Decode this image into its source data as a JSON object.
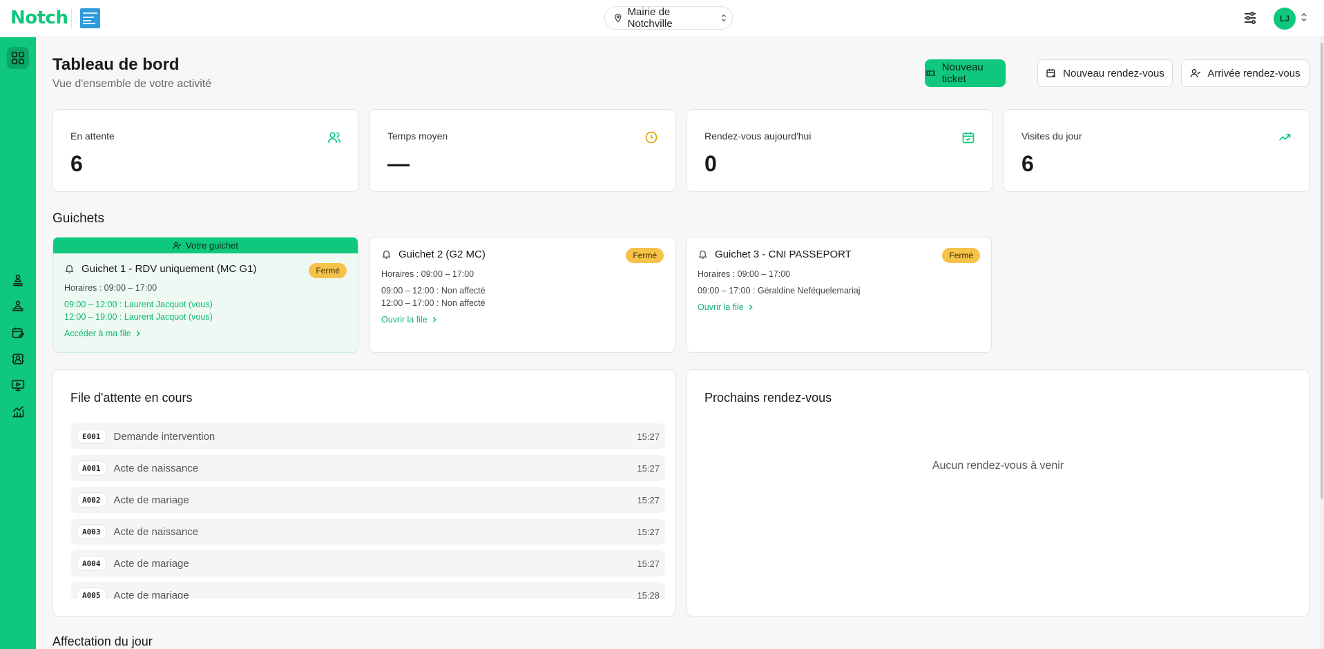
{
  "header": {
    "logo": "Notch",
    "partner_logo": "partner-logo",
    "location": "Mairie de Notchville",
    "avatar_initials": "LJ"
  },
  "sidebar": {
    "items": [
      {
        "icon": "dashboard-icon",
        "active": true
      },
      {
        "icon": "queue-icon"
      },
      {
        "icon": "counter-icon"
      },
      {
        "icon": "calendar-edit-icon"
      },
      {
        "icon": "id-card-icon"
      },
      {
        "icon": "screen-icon"
      },
      {
        "icon": "stats-icon"
      }
    ]
  },
  "page": {
    "title": "Tableau de bord",
    "subtitle": "Vue d'ensemble de votre activité"
  },
  "actions": {
    "new_ticket": "Nouveau ticket",
    "new_appointment": "Nouveau rendez-vous",
    "appointment_arrival": "Arrivée rendez-vous"
  },
  "stats": [
    {
      "label": "En attente",
      "value": "6",
      "icon": "users-icon",
      "color": "#0fc77d"
    },
    {
      "label": "Temps moyen",
      "value": "—",
      "icon": "clock-icon",
      "color": "#e3a008"
    },
    {
      "label": "Rendez-vous aujourd'hui",
      "value": "0",
      "icon": "calendar-check-icon",
      "color": "#0fc77d"
    },
    {
      "label": "Visites du jour",
      "value": "6",
      "icon": "trending-up-icon",
      "color": "#0fc77d"
    }
  ],
  "guichets_section": {
    "title": "Guichets",
    "mine_banner": "Votre guichet",
    "items": [
      {
        "name": "Guichet 1 - RDV uniquement (MC G1)",
        "status": "Fermé",
        "hours": "Horaires : 09:00 – 17:00",
        "slots": [
          "09:00 – 12:00 : Laurent Jacquot (vous)",
          "12:00 – 19:00 : Laurent Jacquot (vous)"
        ],
        "link": "Accéder à ma file"
      },
      {
        "name": "Guichet 2 (G2 MC)",
        "status": "Fermé",
        "hours": "Horaires : 09:00 – 17:00",
        "slots": [
          "09:00 – 12:00 : Non affecté",
          "12:00 – 17:00 : Non affecté"
        ],
        "link": "Ouvrir la file"
      },
      {
        "name": "Guichet 3 - CNI PASSEPORT",
        "status": "Fermé",
        "hours": "Horaires : 09:00 – 17:00",
        "slots": [
          "09:00 – 17:00 : Géraldine Neféquelemariaj"
        ],
        "link": "Ouvrir la file"
      }
    ]
  },
  "queue": {
    "title": "File d'attente en cours",
    "rows": [
      {
        "code": "E001",
        "label": "Demande intervention",
        "time": "15:27"
      },
      {
        "code": "A001",
        "label": "Acte de naissance",
        "time": "15:27"
      },
      {
        "code": "A002",
        "label": "Acte de mariage",
        "time": "15:27"
      },
      {
        "code": "A003",
        "label": "Acte de naissance",
        "time": "15:27"
      },
      {
        "code": "A004",
        "label": "Acte de mariage",
        "time": "15:27"
      },
      {
        "code": "A005",
        "label": "Acte de mariage",
        "time": "15:28"
      }
    ]
  },
  "appointments": {
    "title": "Prochains rendez-vous",
    "empty": "Aucun rendez-vous à venir"
  },
  "affectation": {
    "title": "Affectation du jour"
  },
  "colors": {
    "brand": "#0fc77d",
    "status_closed": "#f6c34a"
  }
}
